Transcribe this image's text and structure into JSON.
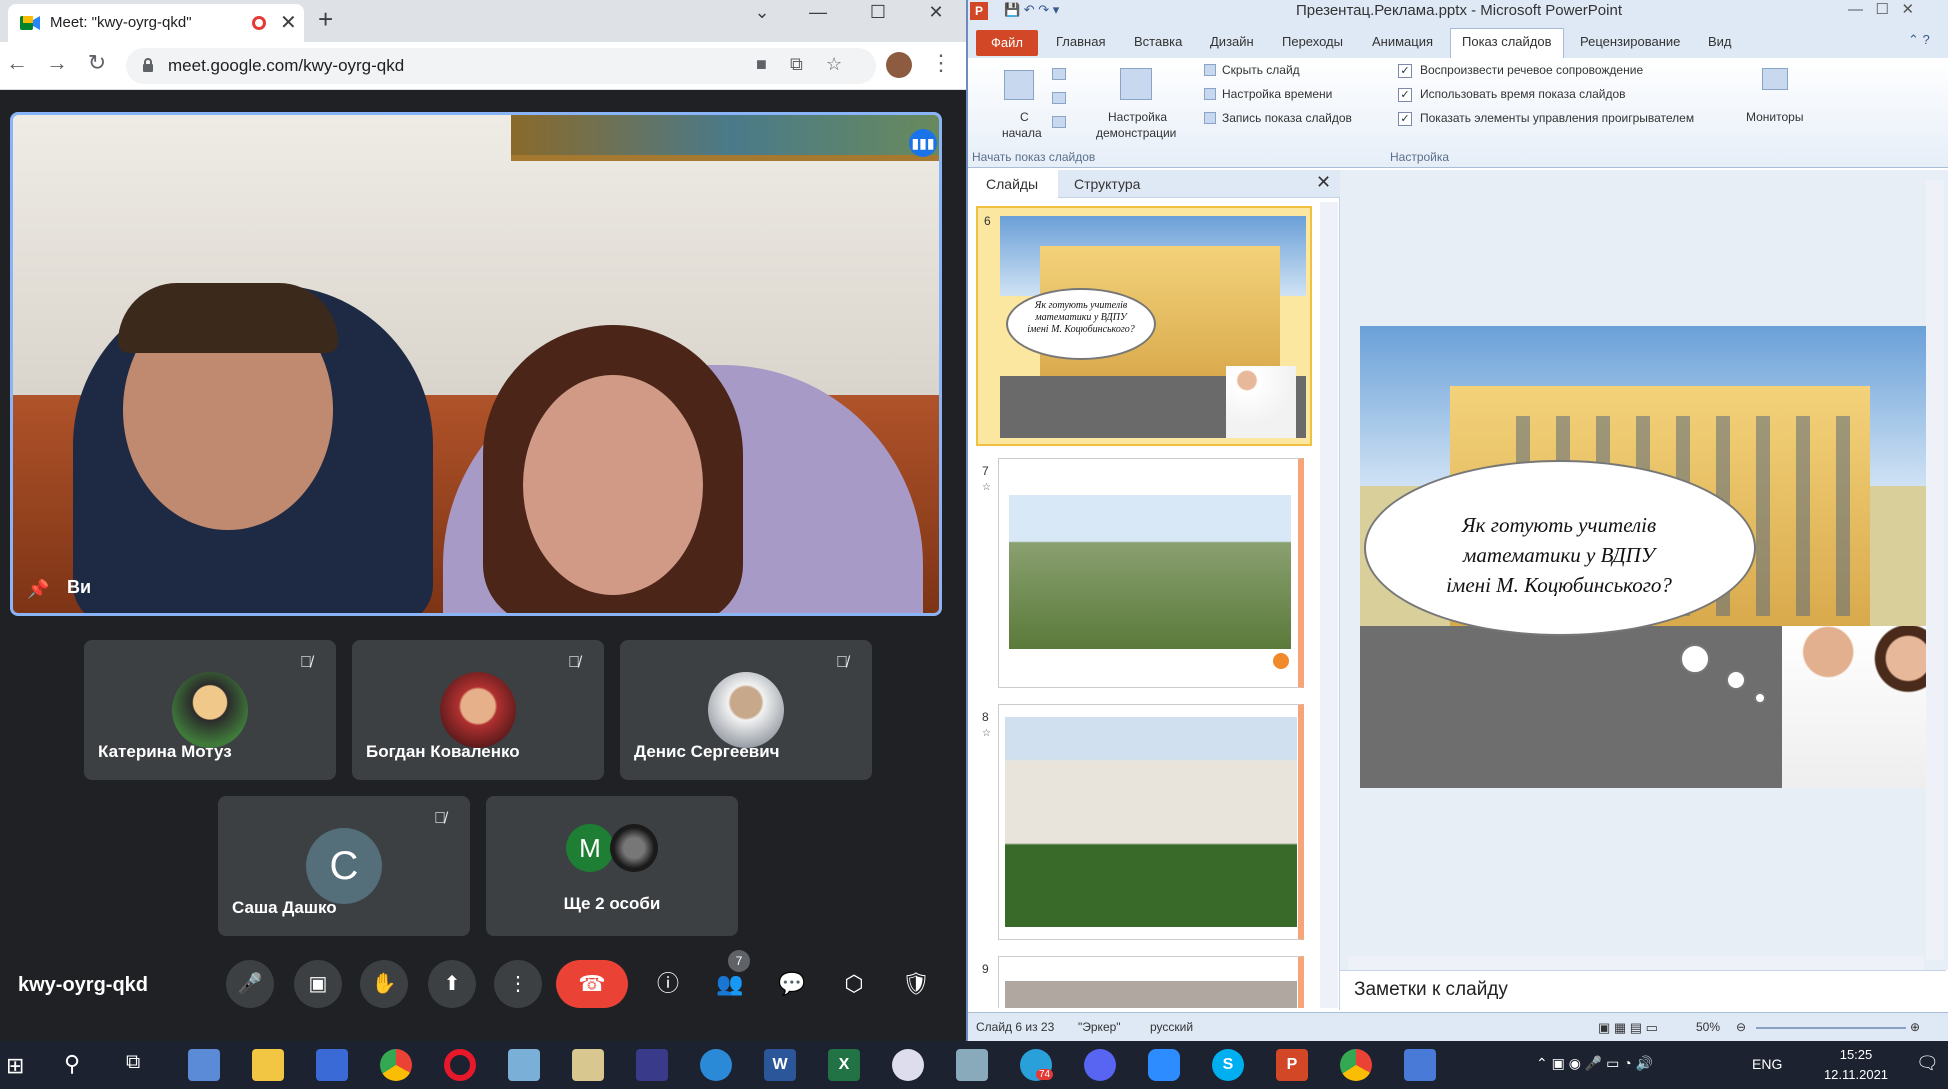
{
  "browser": {
    "tab_title": "Meet: \"kwy-oyrg-qkd\"",
    "url": "meet.google.com/kwy-oyrg-qkd",
    "new_tab_label": "+",
    "close_label": "✕"
  },
  "meet": {
    "self_label": "Ви",
    "participants": [
      {
        "name": "Катерина Мотуз",
        "muted": true
      },
      {
        "name": "Богдан Коваленко",
        "muted": true
      },
      {
        "name": "Денис Сергеевич",
        "muted": true
      },
      {
        "name": "Саша Дашко",
        "initial": "С",
        "muted": true
      },
      {
        "name": "Ще 2 особи",
        "initial": "М"
      }
    ],
    "meeting_code": "kwy-oyrg-qkd",
    "people_count": "7"
  },
  "powerpoint": {
    "window_title": "Презентац.Реклама.pptx - Microsoft PowerPoint",
    "tabs": [
      "Файл",
      "Главная",
      "Вставка",
      "Дизайн",
      "Переходы",
      "Анимация",
      "Показ слайдов",
      "Рецензирование",
      "Вид"
    ],
    "active_tab": "Показ слайдов",
    "ribbon": {
      "from_start_l1": "С",
      "from_start_l2": "начала",
      "setup_l1": "Настройка",
      "setup_l2": "демонстрации",
      "hide_slide": "Скрыть слайд",
      "rehearse": "Настройка времени",
      "record": "Запись показа слайдов",
      "play_narration": "Воспроизвести речевое сопровождение",
      "use_timings": "Использовать время показа слайдов",
      "show_media": "Показать элементы управления проигрывателем",
      "monitors": "Мониторы",
      "group_start": "Начать показ слайдов",
      "group_setup": "Настройка"
    },
    "pane_tabs": [
      "Слайды",
      "Структура"
    ],
    "slides": [
      {
        "num": "6"
      },
      {
        "num": "7"
      },
      {
        "num": "8"
      },
      {
        "num": "9"
      }
    ],
    "slide_text_l1": "Як готують учителів",
    "slide_text_l2": "математики у ВДПУ",
    "slide_text_l3": "імені М. Коцюбинського?",
    "notes_placeholder": "Заметки к слайду",
    "status": {
      "slide": "Слайд 6 из 23",
      "theme": "\"Эркер\"",
      "language": "русский",
      "zoom": "50%"
    }
  },
  "taskbar": {
    "lang": "ENG",
    "time": "15:25",
    "date": "12.11.2021",
    "telegram_badge": "74"
  }
}
